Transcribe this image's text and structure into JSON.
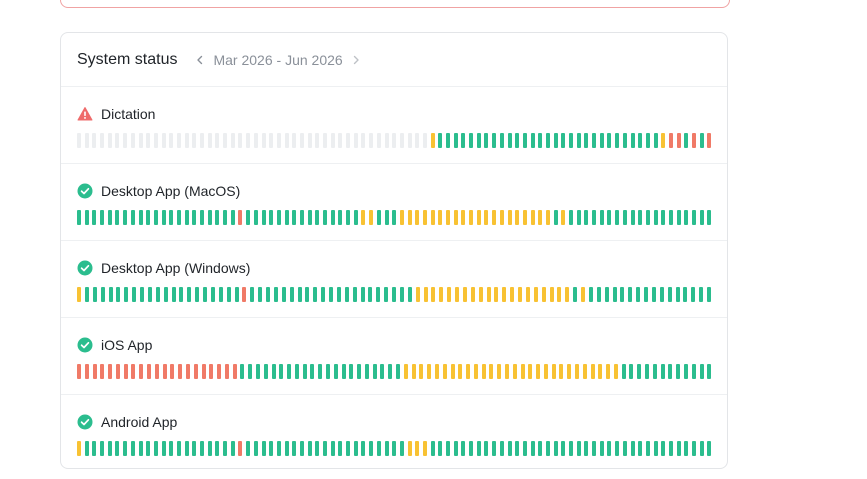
{
  "card": {
    "title": "System status"
  },
  "range": {
    "label": "Mar 2026 - Jun 2026"
  },
  "colors": {
    "ok": "#2bbd8e",
    "degraded": "#f8c233",
    "outage": "#f07a67",
    "nodata": "#eceef0",
    "warn_icon": "#ef6b6b",
    "ok_icon": "#2bbd8e"
  },
  "services": [
    {
      "name": "Dictation",
      "status": "warning",
      "days": "nnnnnnnnnnnnnnnnnnnnnnnnnnnnnnnnnnnnnnnnnnnnnndgggggggggggggggggggggggggggggdrrgrgr"
    },
    {
      "name": "Desktop App (MacOS)",
      "status": "operational",
      "days": "gggggggggggggggggggggrgggggggggggggggddgggddddddddddddddddddddgdggggggggggggggggggg"
    },
    {
      "name": "Desktop App (Windows)",
      "status": "operational",
      "days": "dggggggggggggggggggggrgggggggggggggggggggggddddddddddddddddddddgdgggggggggggggggg"
    },
    {
      "name": "iOS App",
      "status": "operational",
      "days": "rrrrrrrrrrrrrrrrrrrrrgggggggggggggggggggggddddddddddddddddddddddddddddgggggggggggg"
    },
    {
      "name": "Android App",
      "status": "operational",
      "days": "dggggggggggggggggggggrgggggggggggggggggggggdddggggggggggggggggggggggggggggggggggggg"
    }
  ]
}
